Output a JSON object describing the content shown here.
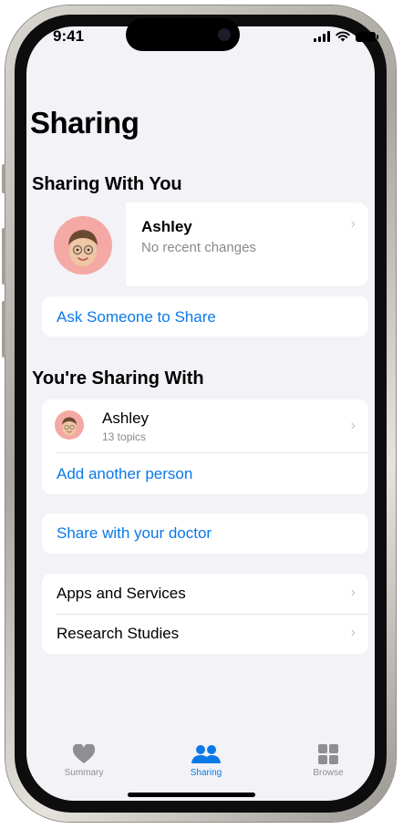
{
  "status_bar": {
    "time": "9:41"
  },
  "page": {
    "title": "Sharing"
  },
  "sharing_with_you": {
    "heading": "Sharing With You",
    "person": {
      "name": "Ashley",
      "subtitle": "No recent changes"
    },
    "ask_link": "Ask Someone to Share"
  },
  "youre_sharing_with": {
    "heading": "You're Sharing With",
    "person": {
      "name": "Ashley",
      "subtitle": "13 topics"
    },
    "add_link": "Add another person"
  },
  "doctor": {
    "link": "Share with your doctor"
  },
  "more": {
    "items": [
      {
        "label": "Apps and Services"
      },
      {
        "label": "Research Studies"
      }
    ]
  },
  "tab_bar": {
    "tabs": [
      {
        "label": "Summary",
        "icon": "heart-icon",
        "selected": false
      },
      {
        "label": "Sharing",
        "icon": "people-icon",
        "selected": true
      },
      {
        "label": "Browse",
        "icon": "grid-icon",
        "selected": false
      }
    ]
  },
  "colors": {
    "accent": "#0a79e8",
    "background": "#f2f2f7",
    "avatar_bg": "#f4a9a4"
  }
}
